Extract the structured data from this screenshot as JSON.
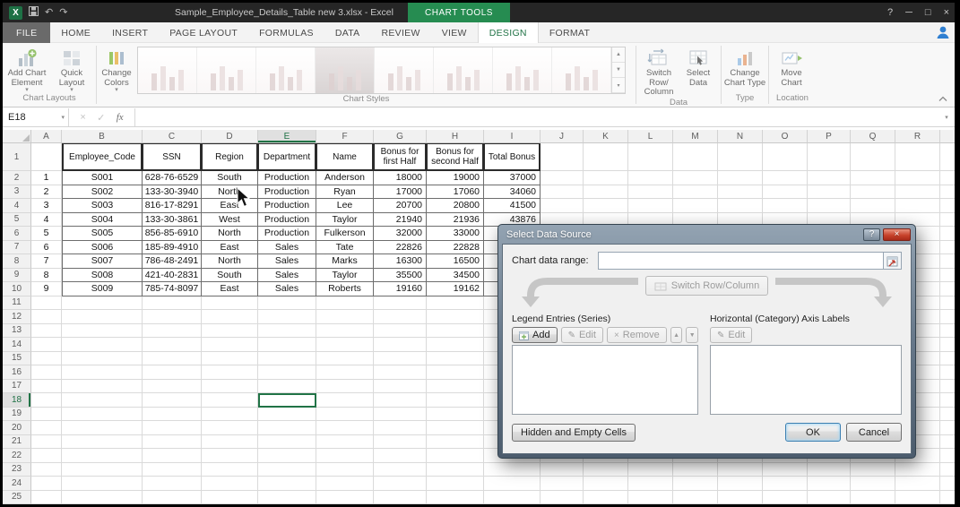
{
  "colors": {
    "excel_green": "#217346",
    "cap_green": "#268c51",
    "close_red": "#c0392b"
  },
  "window": {
    "title": "Sample_Employee_Details_Table new 3.xlsx - Excel",
    "contextual_cap": "CHART TOOLS",
    "help": "?",
    "minimize": "─",
    "maximize": "□",
    "close": "×"
  },
  "icons": {
    "caret": "▾",
    "up": "▲",
    "down": "▼",
    "undo": "↶",
    "redo": "↷",
    "pencil": "✎",
    "remove_x": "×",
    "cancel_x": "×",
    "check": "✓",
    "collapse": "ᐱ"
  },
  "tabs": {
    "file": "FILE",
    "items": [
      "HOME",
      "INSERT",
      "PAGE LAYOUT",
      "FORMULAS",
      "DATA",
      "REVIEW",
      "VIEW"
    ],
    "contextual": [
      "DESIGN",
      "FORMAT"
    ],
    "active": "DESIGN"
  },
  "ribbon": {
    "add_chart_element": "Add Chart Element",
    "quick_layout": "Quick Layout",
    "change_colors": "Change Colors",
    "chart_layouts_group": "Chart Layouts",
    "chart_styles_group": "Chart Styles",
    "switch_row_column": "Switch Row/ Column",
    "select_data": "Select Data",
    "data_group": "Data",
    "change_chart_type": "Change Chart Type",
    "type_group": "Type",
    "move_chart": "Move Chart",
    "location_group": "Location"
  },
  "formula_bar": {
    "name_box": "E18",
    "fx_label": "fx",
    "formula": ""
  },
  "sheet": {
    "col_headers": [
      "A",
      "B",
      "C",
      "D",
      "E",
      "F",
      "G",
      "H",
      "I",
      "J",
      "K",
      "L",
      "M",
      "N",
      "O",
      "P",
      "Q",
      "R"
    ],
    "row_count": 25,
    "active_cell": "E18",
    "active_col": "E",
    "active_row": 18,
    "table": {
      "headers": [
        "Employee_Code",
        "SSN",
        "Region",
        "Department",
        "Name",
        "Bonus for first Half",
        "Bonus for second Half",
        "Total Bonus"
      ],
      "index_col": [
        "1",
        "2",
        "3",
        "4",
        "5",
        "6",
        "7",
        "8",
        "9"
      ],
      "rows": [
        [
          "S001",
          "628-76-6529",
          "South",
          "Production",
          "Anderson",
          "18000",
          "19000",
          "37000"
        ],
        [
          "S002",
          "133-30-3940",
          "North",
          "Production",
          "Ryan",
          "17000",
          "17060",
          "34060"
        ],
        [
          "S003",
          "816-17-8291",
          "East",
          "Production",
          "Lee",
          "20700",
          "20800",
          "41500"
        ],
        [
          "S004",
          "133-30-3861",
          "West",
          "Production",
          "Taylor",
          "21940",
          "21936",
          "43876"
        ],
        [
          "S005",
          "856-85-6910",
          "North",
          "Production",
          "Fulkerson",
          "32000",
          "33000",
          ""
        ],
        [
          "S006",
          "185-89-4910",
          "East",
          "Sales",
          "Tate",
          "22826",
          "22828",
          ""
        ],
        [
          "S007",
          "786-48-2491",
          "North",
          "Sales",
          "Marks",
          "16300",
          "16500",
          ""
        ],
        [
          "S008",
          "421-40-2831",
          "South",
          "Sales",
          "Taylor",
          "35500",
          "34500",
          ""
        ],
        [
          "S009",
          "785-74-8097",
          "East",
          "Sales",
          "Roberts",
          "19160",
          "19162",
          ""
        ]
      ]
    }
  },
  "dialog": {
    "title": "Select Data Source",
    "chart_data_range_label": "Chart data range:",
    "chart_data_range_value": "",
    "switch_button": "Switch Row/Column",
    "legend_section": "Legend Entries (Series)",
    "axis_section": "Horizontal (Category) Axis Labels",
    "add": "Add",
    "edit": "Edit",
    "remove": "Remove",
    "axis_edit": "Edit",
    "hidden_button": "Hidden and Empty Cells",
    "ok": "OK",
    "cancel": "Cancel"
  }
}
